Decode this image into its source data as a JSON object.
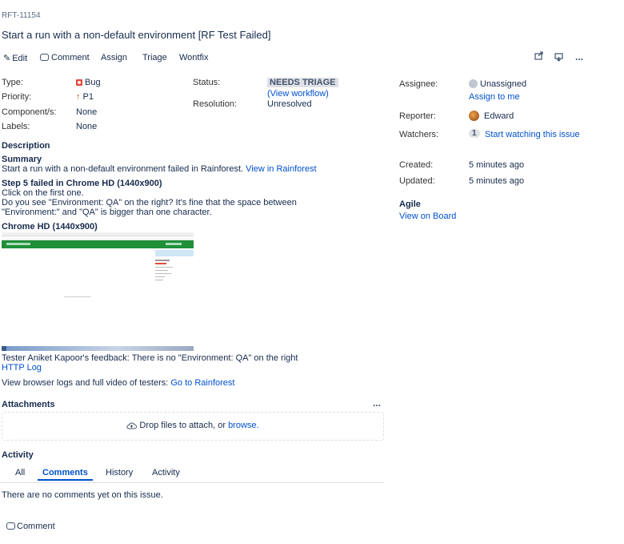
{
  "issue": {
    "key": "RFT-11154",
    "title": "Start a run with a non-default environment [RF Test Failed]"
  },
  "toolbar": {
    "edit": "Edit",
    "comment": "Comment",
    "assign": "Assign",
    "triage": "Triage",
    "wontfix": "Wontfix",
    "more": "..."
  },
  "details": {
    "type_label": "Type:",
    "type_value": "Bug",
    "priority_label": "Priority:",
    "priority_value": "P1",
    "components_label": "Component/s:",
    "components_value": "None",
    "labels_label": "Labels:",
    "labels_value": "None",
    "status_label": "Status:",
    "status_value": "NEEDS TRIAGE",
    "view_workflow": "(View workflow)",
    "resolution_label": "Resolution:",
    "resolution_value": "Unresolved"
  },
  "people": {
    "assignee_label": "Assignee:",
    "assignee_value": "Unassigned",
    "assign_to_me": "Assign to me",
    "reporter_label": "Reporter:",
    "reporter_value": "Edward",
    "watchers_label": "Watchers:",
    "watchers_count": "1",
    "start_watching": "Start watching this issue"
  },
  "dates": {
    "created_label": "Created:",
    "created_value": "5 minutes ago",
    "updated_label": "Updated:",
    "updated_value": "5 minutes ago"
  },
  "agile": {
    "heading": "Agile",
    "view_on_board": "View on Board"
  },
  "description": {
    "heading": "Description",
    "summary_heading": "Summary",
    "summary_text": "Start a run with a non-default environment failed in Rainforest.",
    "summary_link": "View in Rainforest",
    "step_heading": "Step 5 failed in Chrome HD (1440x900)",
    "step_line1": "Click on the first one.",
    "step_line2": "Do you see \"Environment: QA\" on the right? It's fine that the space between",
    "step_line3": "\"Environment:\" and \"QA\" is bigger than one character.",
    "screenshot_heading": "Chrome HD (1440x900)",
    "feedback": "Tester Aniket Kapoor's feedback: There is no \"Environment: QA\" on the right",
    "http_log": "HTTP Log",
    "browser_logs_text": "View browser logs and full video of testers:",
    "go_to_rainforest": "Go to Rainforest"
  },
  "attachments": {
    "heading": "Attachments",
    "more": "...",
    "drop_text": "Drop files to attach, or",
    "browse": "browse."
  },
  "activity": {
    "heading": "Activity",
    "tabs": [
      "All",
      "Comments",
      "History",
      "Activity"
    ],
    "empty_text": "There are no comments yet on this issue.",
    "comment_button": "Comment"
  },
  "colors": {
    "link": "#0052cc",
    "bug_red": "#e5493a",
    "priority_red": "#d04437",
    "screenshot_green": "#1f8f3a"
  }
}
